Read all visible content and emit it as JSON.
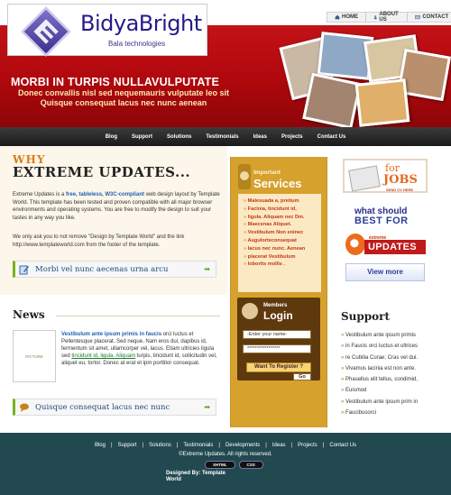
{
  "brand": {
    "name": "BidyaBright",
    "tagline": "Bala technologies"
  },
  "topnav": [
    {
      "label": "HOME",
      "icon": "house-icon"
    },
    {
      "label": "ABOUT US",
      "icon": "person-icon"
    },
    {
      "label": "CONTACT",
      "icon": "mail-icon"
    }
  ],
  "hero": {
    "title": "MORBI IN TURPIS NULLAVULPUTATE",
    "subtitle": "Donec convallis nisl sed nequemauris vulputate leo sit Quisque consequat lacus nec nunc aenean"
  },
  "mainnav": [
    "Blog",
    "Support",
    "Solutions",
    "Testimonials",
    "Ideas",
    "Projects",
    "Contact Us"
  ],
  "intro": {
    "why": "WHY",
    "heading": "EXTREME UPDATES...",
    "p1_a": "Extreme Updates is a ",
    "p1_b": "free, tableless, W3C-compliant",
    "p1_c": " web design layout by Template World. This template has been tested and proven compatible with all major browser environments and operating systems. You are free to modify the design to suit your tastes in any way you like.",
    "p2_a": "We only ask you to not remove ",
    "p2_b": "\"Design by Template World\"",
    "p2_c": " and the link http://www.templateworld.com from the footer of the template."
  },
  "bar1": "Morbi vel nunc aecenas urna arcu",
  "bar2": "Quisque consequat lacus nec nunc",
  "services": {
    "kicker": "Important",
    "title": "Services",
    "items": [
      "Malesuada a, pretium",
      "Facinia, tincidunt id,",
      "ligula. Aliquam nec Dm.",
      "Maecenas Aliquet.",
      "Vestibulum Non eninec",
      "AuguIorteconsequat",
      "lacus nec nunc. Aenean",
      "placerat Vestibulum",
      "lobortis mollis ."
    ]
  },
  "login": {
    "kicker": "Members",
    "title": "Login",
    "name_placeholder": "-Enter your name-",
    "password_value": "*****************",
    "register_label": "Want To Register ?",
    "go_label": "Go"
  },
  "jobs": {
    "for": "for",
    "jobs": "JOBS",
    "sub": "SEND CV HERE"
  },
  "best": {
    "line1": "what should",
    "line2": "BEST FOR"
  },
  "extreme_badge": {
    "small": "extreme",
    "big": "UPDATES"
  },
  "viewmore": "View more",
  "news": {
    "heading": "News",
    "pic_label": "PICTURE",
    "title": "Vestibulum ante ipsum primis in faucis",
    "body1": "orci luctus et Pellentesque placerat. Sed neque. Nam eros dui, dapibus id, fermentum sit amet, ullamcorper vel, lacus. Etiam ultricies ligula sed",
    "link": "tincidunt id, ligula. Aliquam",
    "body2": " turpis, tincidunt id, sollicitudin vel, aliquet eu, tortor. Donec at erat et ipm porttitor consequat."
  },
  "support": {
    "heading": "Support",
    "items": [
      "Vestibulum ante ipsum primis",
      "in Faucis orci luctus et ultrices",
      "re Cubilia Curae; Cras vel dui.",
      "Vivamus lacinia est non ante.",
      "Phasellus elit tellus, condimid,",
      "Euismod",
      "Vestibulum ante ipsum prim in",
      "Faucibusorci"
    ]
  },
  "footer": {
    "nav": [
      "Blog",
      "Support",
      "Solutions",
      "Testimonials",
      "Developments",
      "Ideas",
      "Projects",
      "Contact Us"
    ],
    "copyright": "©Extreme Updates. All rights reserved.",
    "badges": [
      "XHTML",
      "CSS"
    ],
    "designed": "Designed By: Template World"
  },
  "colors": {
    "header_red": "#c8161b",
    "nav_dark": "#2a2a2a",
    "services_gold": "#d6a12c",
    "login_brown": "#5e390d",
    "footer_teal": "#21494f",
    "accent_orange": "#d97f1b",
    "link_blue": "#1f5fb5"
  }
}
